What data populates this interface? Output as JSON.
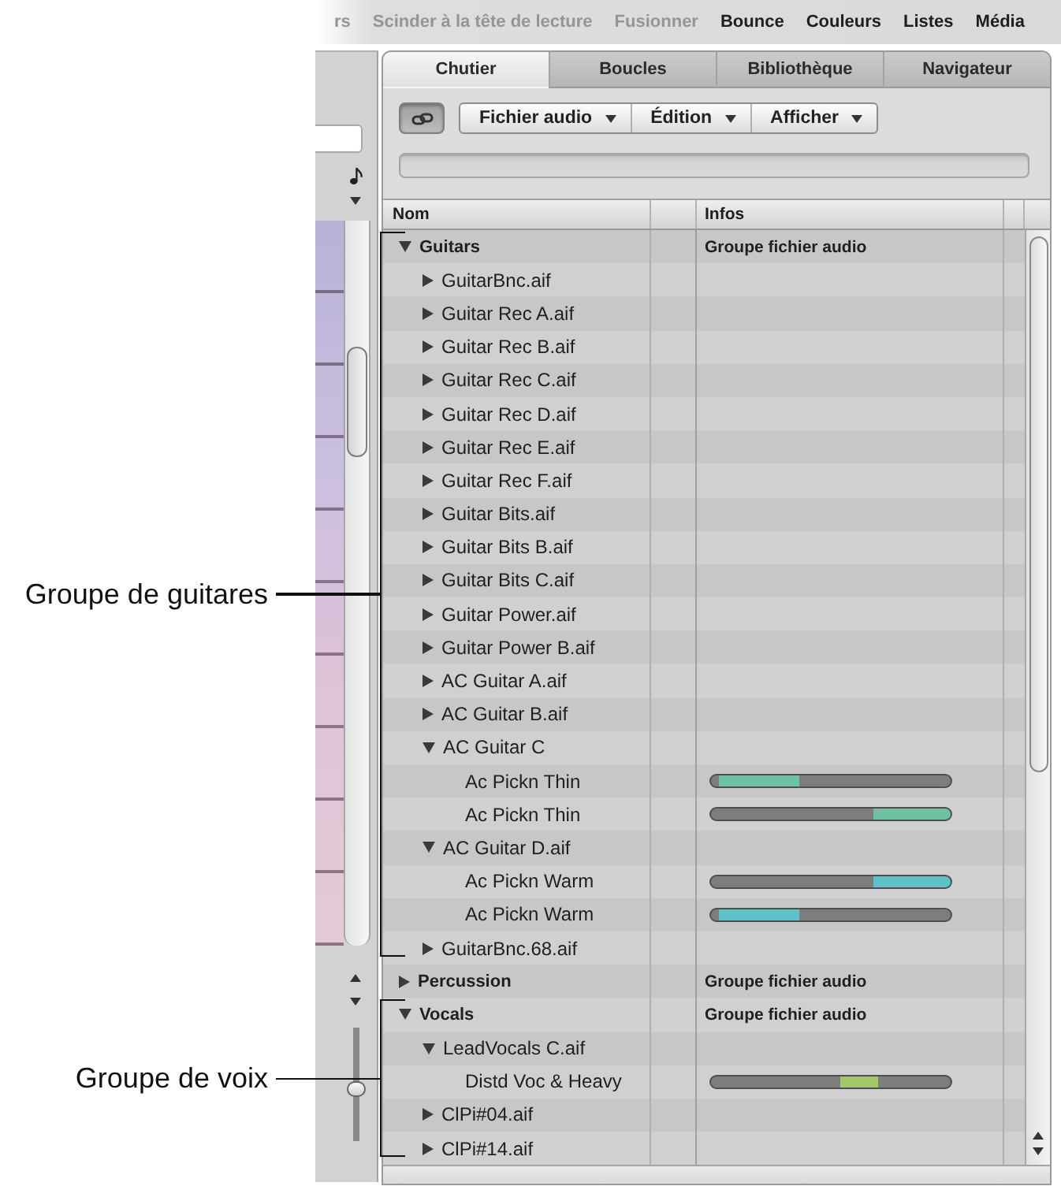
{
  "menu": [
    {
      "label": "rs",
      "disabled": true
    },
    {
      "label": "Scinder à la tête de lecture",
      "disabled": true
    },
    {
      "label": "Fusionner",
      "disabled": true
    },
    {
      "label": "Bounce",
      "disabled": false
    },
    {
      "label": "Couleurs",
      "disabled": false
    },
    {
      "label": "Listes",
      "disabled": false
    },
    {
      "label": "Média",
      "disabled": false
    }
  ],
  "left_panel": {
    "zoom_slider": {
      "level": 0.45
    }
  },
  "tabs": [
    {
      "label": "Chutier",
      "selected": true
    },
    {
      "label": "Boucles",
      "selected": false
    },
    {
      "label": "Bibliothèque",
      "selected": false
    },
    {
      "label": "Navigateur",
      "selected": false
    }
  ],
  "toolbar": {
    "link_button": {
      "on": true
    },
    "menus": [
      {
        "label": "Fichier audio"
      },
      {
        "label": "Édition"
      },
      {
        "label": "Afficher"
      }
    ]
  },
  "table": {
    "columns": [
      {
        "label": "Nom"
      },
      {
        "label": "Infos"
      }
    ],
    "rows": [
      {
        "kind": "group",
        "name": "Guitars",
        "info": "Groupe fichier audio",
        "expanded": true,
        "callout": "Groupe de guitares",
        "children": [
          {
            "kind": "file",
            "name": "GuitarBnc.aif",
            "expanded": false
          },
          {
            "kind": "file",
            "name": "Guitar Rec A.aif",
            "expanded": false
          },
          {
            "kind": "file",
            "name": "Guitar Rec B.aif",
            "expanded": false
          },
          {
            "kind": "file",
            "name": "Guitar Rec C.aif",
            "expanded": false
          },
          {
            "kind": "file",
            "name": "Guitar Rec D.aif",
            "expanded": false
          },
          {
            "kind": "file",
            "name": "Guitar Rec E.aif",
            "expanded": false
          },
          {
            "kind": "file",
            "name": "Guitar Rec F.aif",
            "expanded": false
          },
          {
            "kind": "file",
            "name": "Guitar Bits.aif",
            "expanded": false
          },
          {
            "kind": "file",
            "name": "Guitar Bits B.aif",
            "expanded": false
          },
          {
            "kind": "file",
            "name": "Guitar Bits C.aif",
            "expanded": false
          },
          {
            "kind": "file",
            "name": "Guitar Power.aif",
            "expanded": false
          },
          {
            "kind": "file",
            "name": "Guitar Power B.aif",
            "expanded": false
          },
          {
            "kind": "file",
            "name": "AC Guitar A.aif",
            "expanded": false
          },
          {
            "kind": "file",
            "name": "AC Guitar B.aif",
            "expanded": false
          },
          {
            "kind": "file",
            "name": "AC Guitar C",
            "expanded": true,
            "children": [
              {
                "kind": "region",
                "name": "Ac Pickn Thin",
                "color": "#6ec2a2",
                "region": [
                  {
                    "level": 0.03,
                    "active": false
                  },
                  {
                    "active": true
                  },
                  {
                    "level": 0.63,
                    "active": false
                  }
                ]
              },
              {
                "kind": "region",
                "name": "Ac Pickn Thin",
                "color": "#6ec2a2",
                "region": [
                  {
                    "level": 0.68,
                    "active": false
                  },
                  {
                    "active": true
                  }
                ]
              }
            ]
          },
          {
            "kind": "file",
            "name": "AC Guitar D.aif",
            "expanded": true,
            "children": [
              {
                "kind": "region",
                "name": "Ac Pickn Warm",
                "color": "#5fc0c8",
                "region": [
                  {
                    "level": 0.68,
                    "active": false
                  },
                  {
                    "active": true
                  }
                ]
              },
              {
                "kind": "region",
                "name": "Ac Pickn Warm",
                "color": "#5fc0c8",
                "region": [
                  {
                    "level": 0.03,
                    "active": false
                  },
                  {
                    "active": true
                  },
                  {
                    "level": 0.63,
                    "active": false
                  }
                ]
              }
            ]
          },
          {
            "kind": "file",
            "name": "GuitarBnc.68.aif",
            "expanded": false
          }
        ]
      },
      {
        "kind": "group",
        "name": "Percussion",
        "info": "Groupe fichier audio",
        "expanded": false
      },
      {
        "kind": "group",
        "name": "Vocals",
        "info": "Groupe fichier audio",
        "expanded": true,
        "callout": "Groupe de voix",
        "children": [
          {
            "kind": "file",
            "name": "LeadVocals C.aif",
            "expanded": true,
            "children": [
              {
                "kind": "region",
                "name": "Distd Voc & Heavy",
                "color": "#a3c86a",
                "region": [
                  {
                    "level": 0.54,
                    "active": false
                  },
                  {
                    "active": true
                  },
                  {
                    "level": 0.3,
                    "active": false
                  }
                ]
              }
            ]
          },
          {
            "kind": "file",
            "name": "ClPi#04.aif",
            "expanded": false
          },
          {
            "kind": "file",
            "name": "ClPi#14.aif",
            "expanded": false
          }
        ]
      }
    ]
  }
}
